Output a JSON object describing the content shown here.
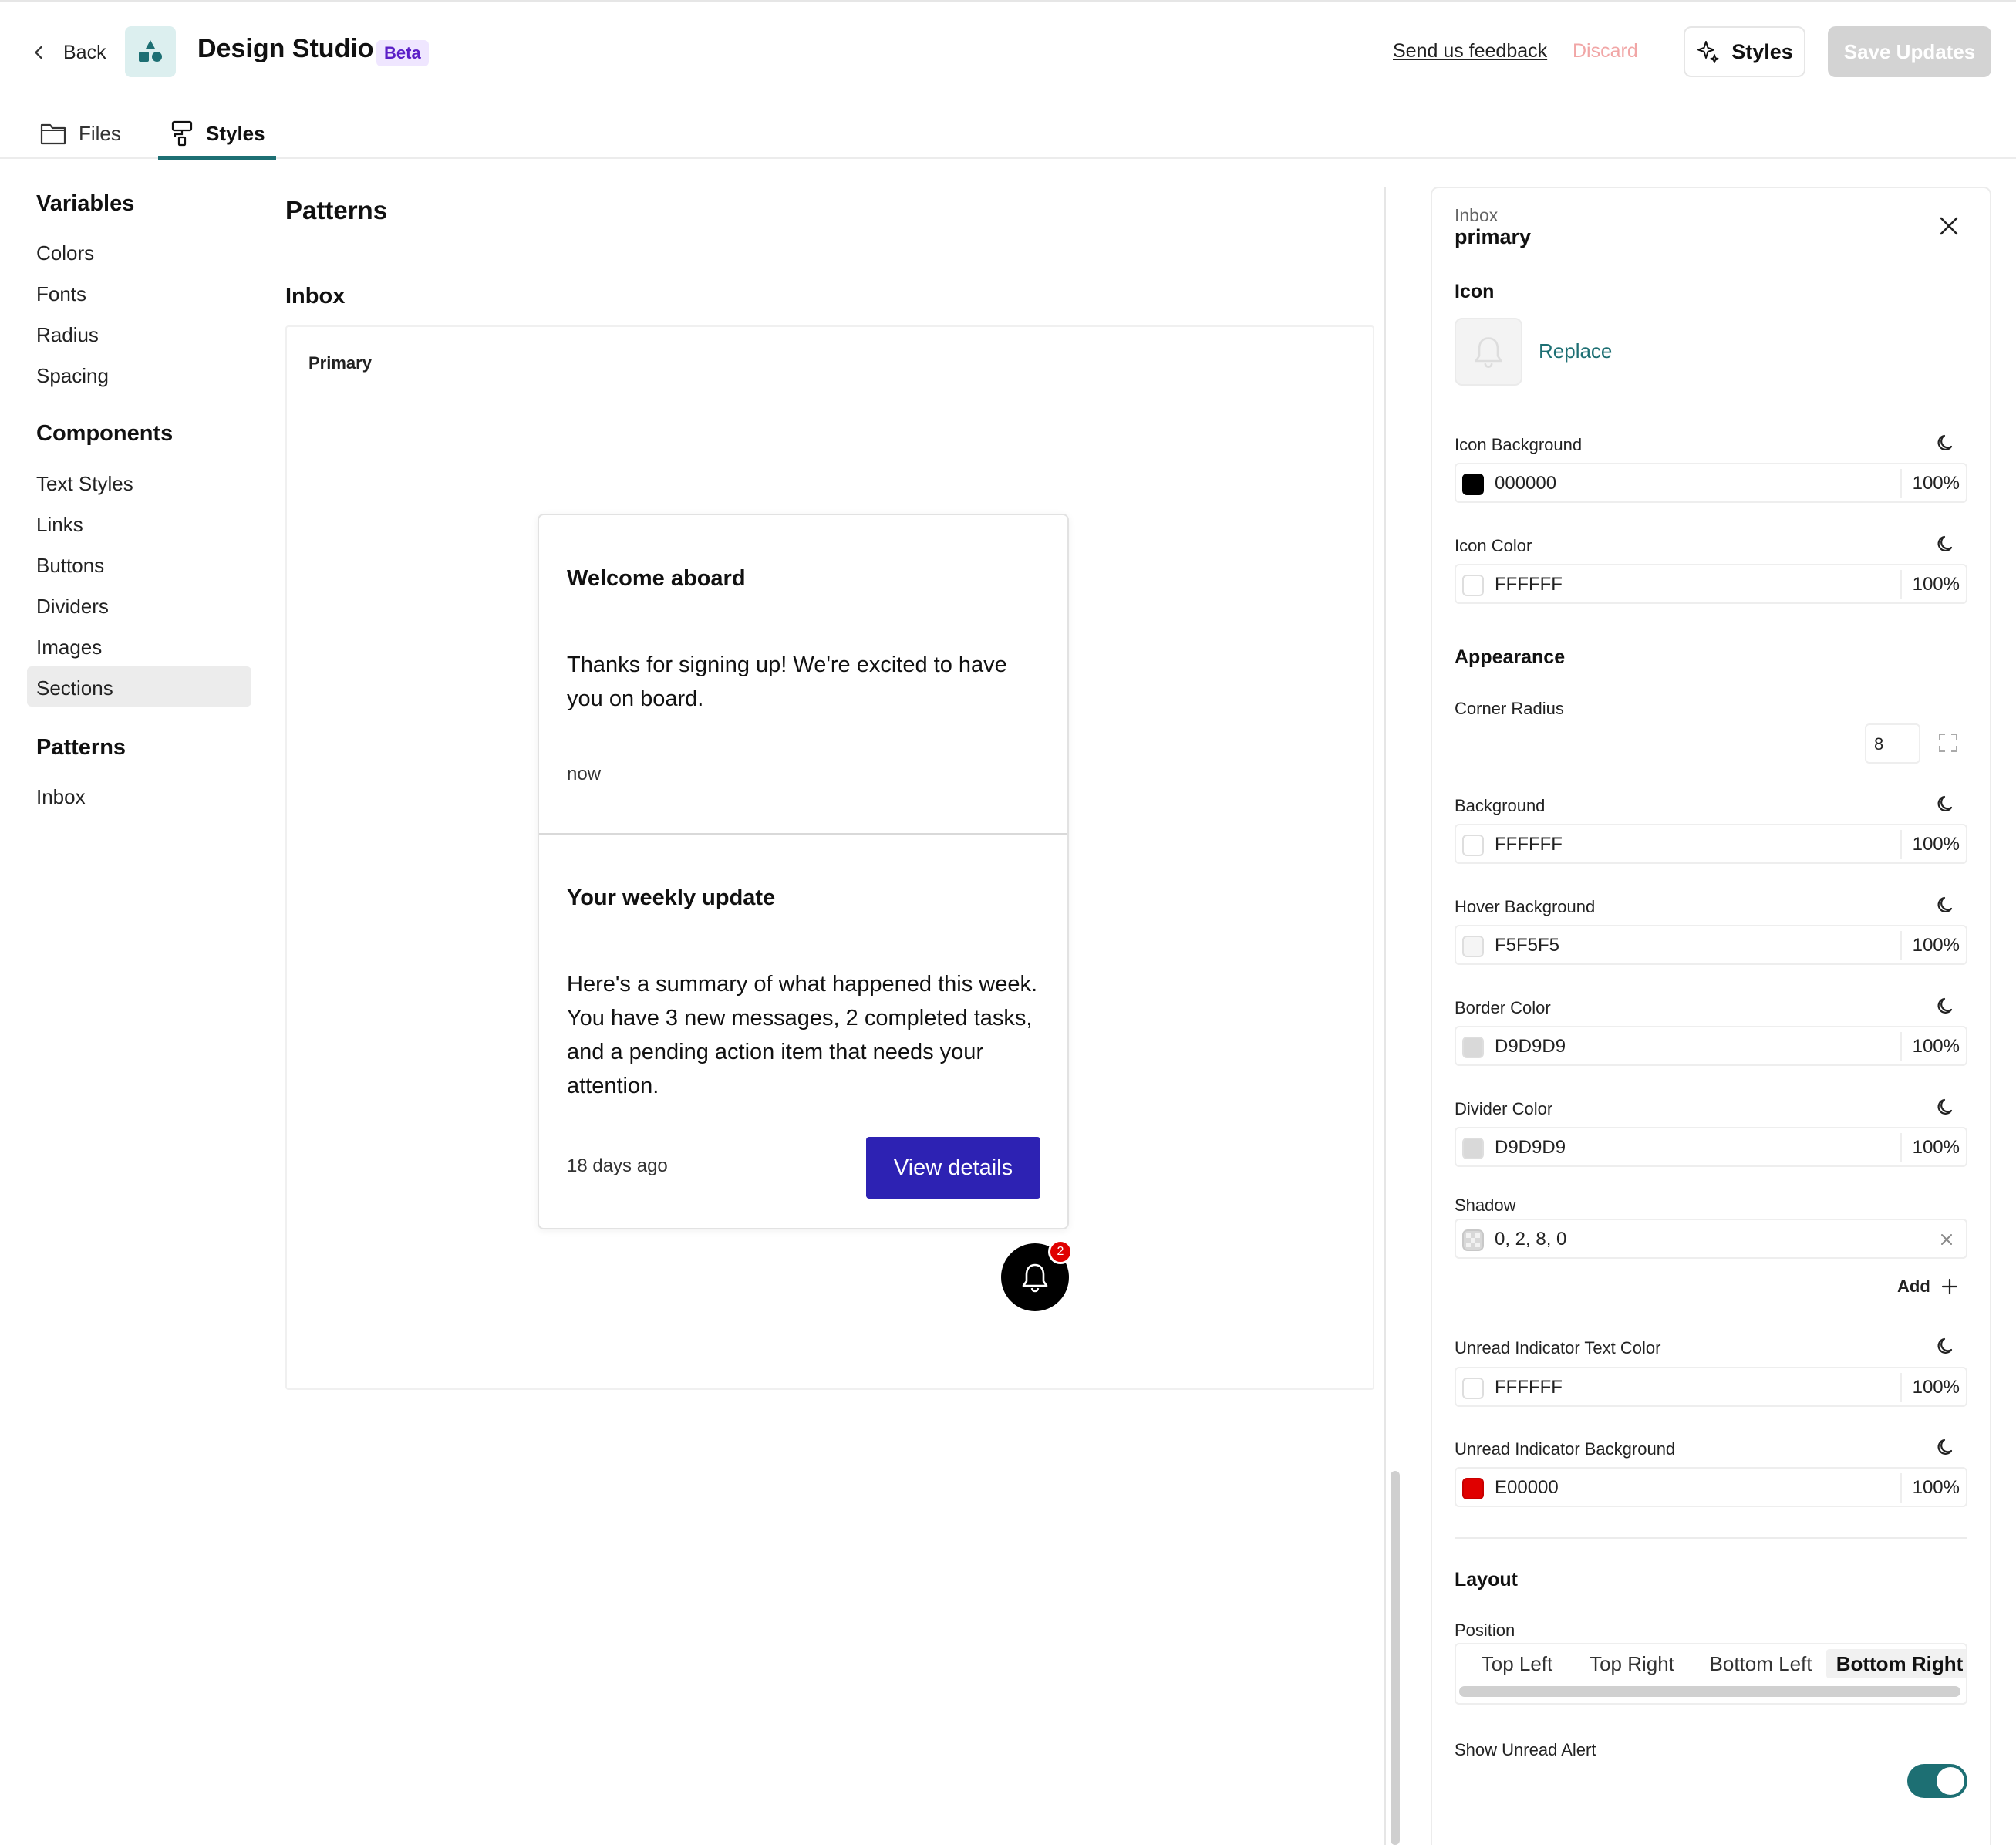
{
  "header": {
    "back_label": "Back",
    "app_title": "Design Studio",
    "badge": "Beta",
    "feedback_link": "Send us feedback",
    "discard_label": "Discard",
    "styles_label": "Styles",
    "save_label": "Save Updates",
    "tabs": [
      {
        "label": "Files",
        "icon": "folder-icon"
      },
      {
        "label": "Styles",
        "icon": "paint-roller-icon",
        "active": true
      }
    ]
  },
  "sidebar": {
    "sections": [
      {
        "heading": "Variables",
        "items": [
          "Colors",
          "Fonts",
          "Radius",
          "Spacing"
        ]
      },
      {
        "heading": "Components",
        "items": [
          "Text Styles",
          "Links",
          "Buttons",
          "Dividers",
          "Images",
          "Sections"
        ]
      },
      {
        "heading": "Patterns",
        "items": [
          "Inbox"
        ]
      }
    ],
    "selected": "Sections"
  },
  "main": {
    "title": "Patterns",
    "section_title": "Inbox",
    "preview_label": "Primary",
    "notifications": [
      {
        "title": "Welcome aboard",
        "body": "Thanks for signing up! We're excited to have you on board.",
        "time": "now"
      },
      {
        "title": "Your weekly update",
        "body": "Here's a summary of what happened this week. You have 3 new messages, 2 completed tasks, and a pending action item that needs your attention.",
        "time": "18 days ago",
        "action": "View details"
      }
    ],
    "bell_badge_count": "2"
  },
  "panel": {
    "breadcrumb": "Inbox",
    "title": "primary",
    "icon_section": "Icon",
    "replace_label": "Replace",
    "icon_background": {
      "label": "Icon Background",
      "hex": "000000",
      "opacity": "100%",
      "swatch": "#000000"
    },
    "icon_color": {
      "label": "Icon Color",
      "hex": "FFFFFF",
      "opacity": "100%",
      "swatch": "#FFFFFF"
    },
    "appearance_section": "Appearance",
    "corner_radius_label": "Corner Radius",
    "corner_radius_value": "8",
    "background": {
      "label": "Background",
      "hex": "FFFFFF",
      "opacity": "100%",
      "swatch": "#FFFFFF"
    },
    "hover_background": {
      "label": "Hover Background",
      "hex": "F5F5F5",
      "opacity": "100%",
      "swatch": "#F5F5F5"
    },
    "border_color": {
      "label": "Border Color",
      "hex": "D9D9D9",
      "opacity": "100%",
      "swatch": "#D9D9D9"
    },
    "divider_color": {
      "label": "Divider Color",
      "hex": "D9D9D9",
      "opacity": "100%",
      "swatch": "#D9D9D9"
    },
    "shadow_label": "Shadow",
    "shadow_value": "0, 2, 8, 0",
    "add_label": "Add",
    "unread_text_color": {
      "label": "Unread Indicator Text Color",
      "hex": "FFFFFF",
      "opacity": "100%",
      "swatch": "#FFFFFF"
    },
    "unread_background": {
      "label": "Unread Indicator Background",
      "hex": "E00000",
      "opacity": "100%",
      "swatch": "#E00000"
    },
    "layout_section": "Layout",
    "position_label": "Position",
    "position_options": [
      "Top Left",
      "Top Right",
      "Bottom Left",
      "Bottom Right"
    ],
    "position_selected": "Bottom Right",
    "show_unread_label": "Show Unread Alert",
    "show_unread_enabled": true
  },
  "colors": {
    "accent": "#1D6F73",
    "primary_button": "#2D22B3",
    "badge_red": "#E00000",
    "beta_text": "#5B1FC7"
  }
}
